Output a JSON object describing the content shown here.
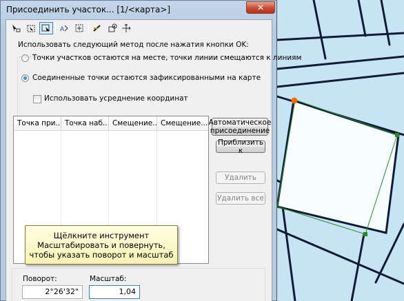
{
  "window": {
    "title": "Присоединить участок... [1/<карта>]",
    "close_glyph": "✕"
  },
  "toolbar": {
    "icons": [
      "move-parcel-icon",
      "select-points-icon",
      "select-link-icon",
      "auto-join-icon",
      "zoom-fit-icon",
      "add-link-icon",
      "settings-icon",
      "pan-icon"
    ],
    "active_index": 2
  },
  "method": {
    "heading": "Использовать следующий метод после нажатия кнопки OK:",
    "option_snap": "Точки участков остаются на месте, точки линии смещаются к линиям",
    "option_fixed": "Соединенные точки остаются зафиксированными на карте",
    "selected": "option_fixed",
    "average_label": "Использовать усреднение координат",
    "average_checked": false
  },
  "table": {
    "columns": [
      "Точка при...",
      "Точка наб...",
      "Смещение...",
      "Смещение..."
    ],
    "rows": []
  },
  "buttons": {
    "auto_join": "Автоматическое\nприсоединение",
    "zoom_to": "Приблизить к",
    "delete": "Удалить",
    "delete_all": "Удалить все"
  },
  "tooltip": {
    "text": "Щёлкните инструмент\nМасштабировать и повернуть,\nчтобы указать поворот и масштаб"
  },
  "transform": {
    "rotation_label": "Поворот:",
    "rotation_value": "2°26'32\"",
    "scale_label": "Масштаб:",
    "scale_value": "1,04"
  },
  "colors": {
    "map_background": "#c8e4f4",
    "parcel_fill": "#f7fcff",
    "line_dark": "#0d1b33",
    "link_green": "#2a8a2a",
    "selected_point": "#ff6a00"
  }
}
